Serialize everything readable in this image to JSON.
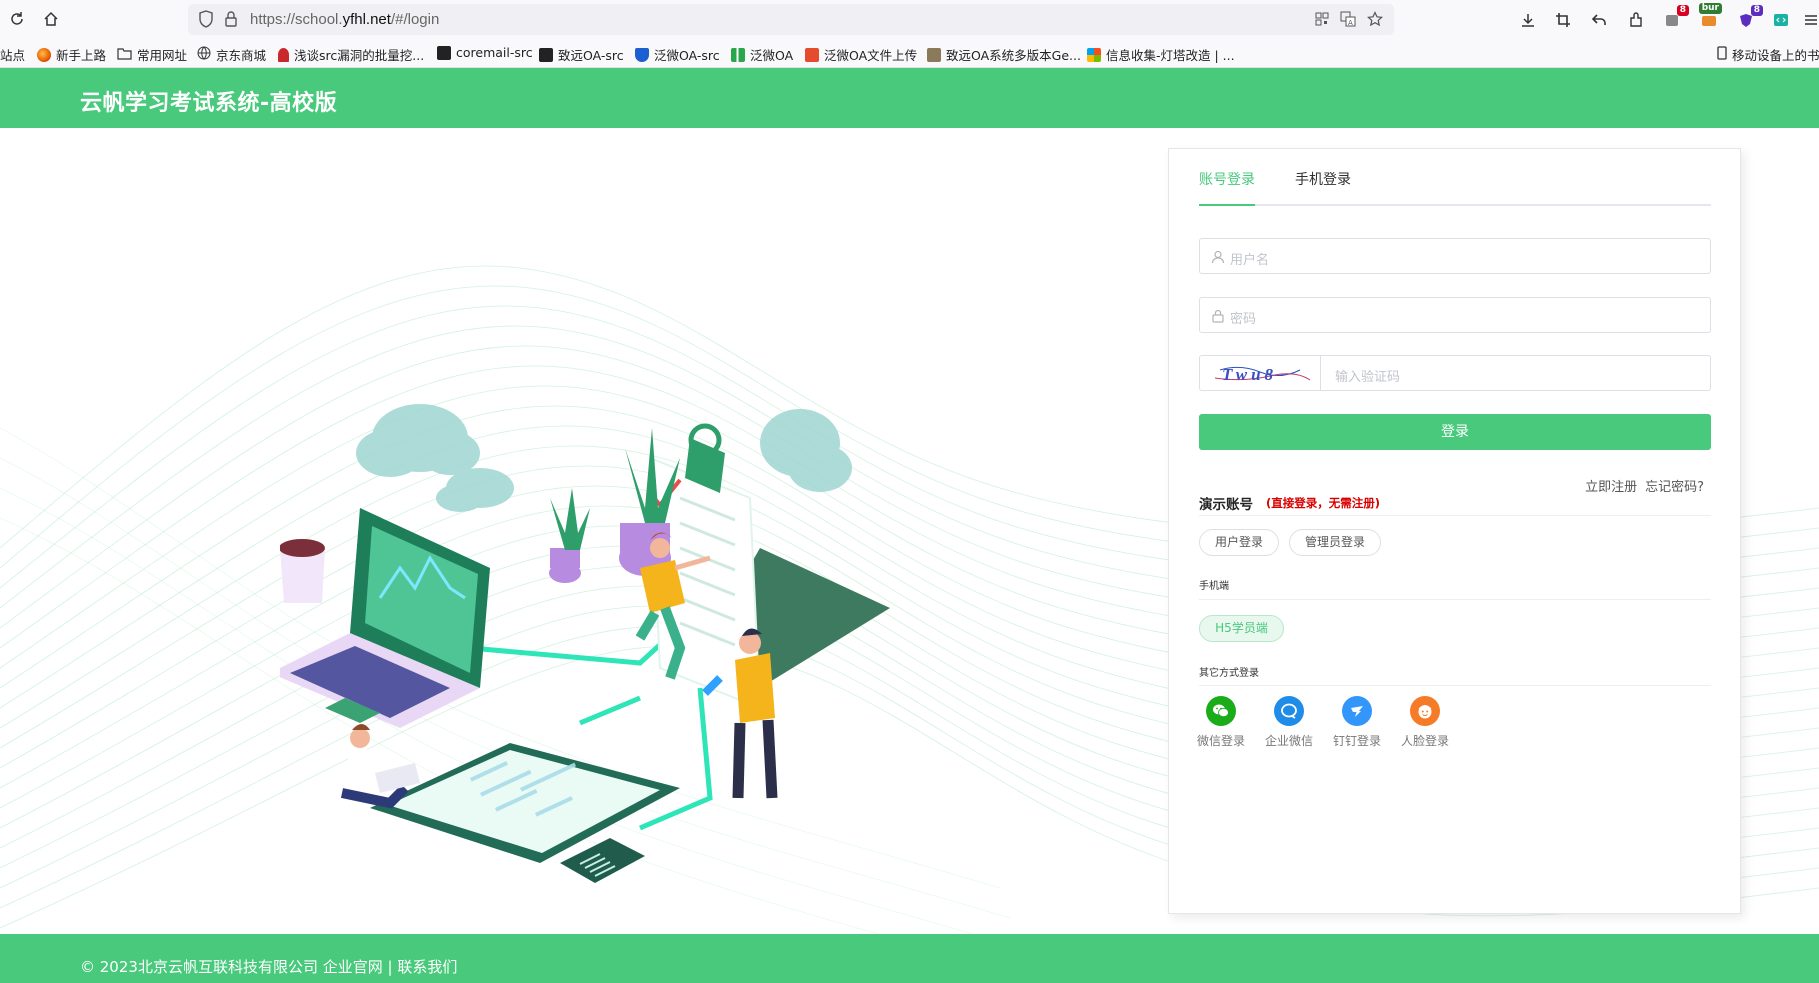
{
  "browser": {
    "url_prefix": "https://school.",
    "url_domain": "yfhl.net",
    "url_suffix": "/#/login",
    "badge_a": "8",
    "badge_b": "bur",
    "badge_c": "8"
  },
  "bookmarks": [
    {
      "label": "站点",
      "icon": "none"
    },
    {
      "label": "新手上路",
      "icon": "firefox-icon"
    },
    {
      "label": "常用网址",
      "icon": "folder-icon"
    },
    {
      "label": "京东商城",
      "icon": "globe-icon"
    },
    {
      "label": "浅谈src漏洞的批量挖...",
      "icon": "site-icon"
    },
    {
      "label": "coremail-src",
      "icon": "site-icon"
    },
    {
      "label": "致远OA-src",
      "icon": "site-icon"
    },
    {
      "label": "泛微OA-src",
      "icon": "shield-icon"
    },
    {
      "label": "泛微OA",
      "icon": "site-icon"
    },
    {
      "label": "泛微OA文件上传",
      "icon": "site-icon"
    },
    {
      "label": "致远OA系统多版本Ge...",
      "icon": "site-icon"
    },
    {
      "label": "信息收集-灯塔改造 | ...",
      "icon": "site-icon"
    },
    {
      "label": "移动设备上的书签",
      "icon": "mobile-icon"
    }
  ],
  "header": {
    "title": "云帆学习考试系统-高校版"
  },
  "login": {
    "tabs": [
      {
        "label": "账号登录",
        "active": true
      },
      {
        "label": "手机登录",
        "active": false
      }
    ],
    "username_placeholder": "用户名",
    "password_placeholder": "密码",
    "captcha_text": "Twu8",
    "captcha_placeholder": "输入验证码",
    "submit_label": "登录",
    "register_link": "立即注册",
    "forgot_link": "忘记密码?",
    "demo_title": "演示账号",
    "demo_note": "(直接登录，无需注册)",
    "demo_buttons": [
      "用户登录",
      "管理员登录"
    ],
    "mobile_title": "手机端",
    "mobile_button": "H5学员端",
    "other_title": "其它方式登录",
    "oauth": [
      {
        "label": "微信登录",
        "icon": "wechat-icon",
        "color": "#1aad19"
      },
      {
        "label": "企业微信",
        "icon": "wework-icon",
        "color": "#1f8ce8"
      },
      {
        "label": "钉钉登录",
        "icon": "dingtalk-icon",
        "color": "#3296fa"
      },
      {
        "label": "人脸登录",
        "icon": "face-icon",
        "color": "#f57b26"
      }
    ]
  },
  "footer": {
    "copyright": "© 2023北京云帆互联科技有限公司",
    "link_site": "企业官网",
    "separator": "|",
    "link_contact": "联系我们"
  },
  "colors": {
    "brand": "#48c97c",
    "danger": "#d80000"
  }
}
